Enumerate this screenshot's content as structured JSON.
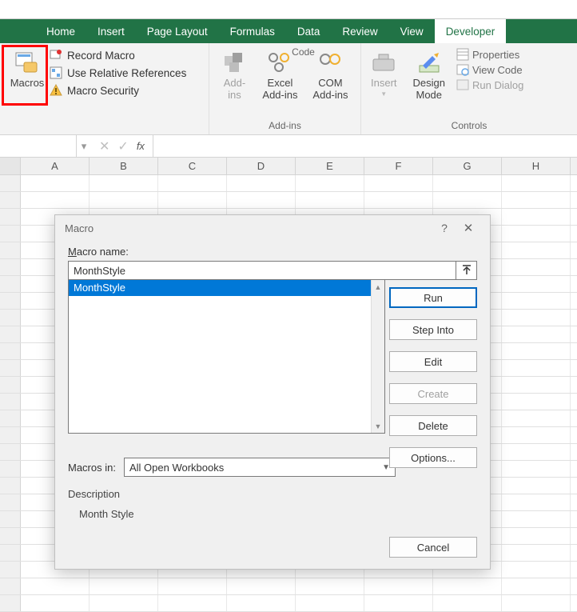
{
  "tabs": {
    "home": "Home",
    "insert": "Insert",
    "pageLayout": "Page Layout",
    "formulas": "Formulas",
    "data": "Data",
    "review": "Review",
    "view": "View",
    "developer": "Developer"
  },
  "ribbon": {
    "code": {
      "macros": "Macros",
      "record": "Record Macro",
      "useRel": "Use Relative References",
      "security": "Macro Security",
      "groupLabel": "Code"
    },
    "addins": {
      "addins": "Add-\nins",
      "excel": "Excel\nAdd-ins",
      "com": "COM\nAdd-ins",
      "groupLabel": "Add-ins"
    },
    "controls": {
      "insert": "Insert",
      "design": "Design\nMode",
      "properties": "Properties",
      "viewCode": "View Code",
      "runDialog": "Run Dialog",
      "groupLabel": "Controls"
    }
  },
  "columns": [
    "A",
    "B",
    "C",
    "D",
    "E",
    "F",
    "G",
    "H"
  ],
  "dialog": {
    "title": "Macro",
    "nameLabel": "Macro name:",
    "nameValue": "MonthStyle",
    "listItems": [
      "MonthStyle"
    ],
    "buttons": {
      "run": "Run",
      "step": "Step Into",
      "edit": "Edit",
      "create": "Create",
      "delete": "Delete",
      "options": "Options..."
    },
    "macrosInLabel": "Macros in:",
    "macrosInValue": "All Open Workbooks",
    "descLabel": "Description",
    "descValue": "Month Style",
    "cancel": "Cancel"
  },
  "fx_label": "fx"
}
